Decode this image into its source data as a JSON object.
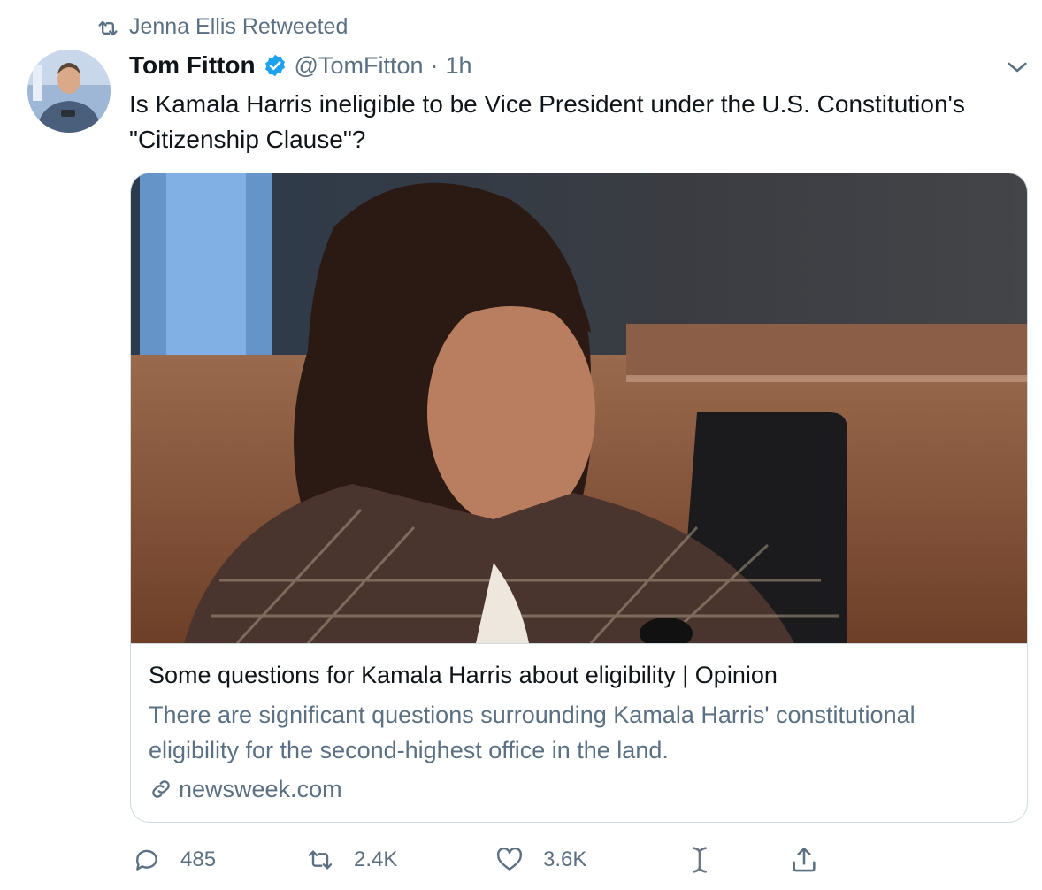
{
  "retweet_context": {
    "icon": "retweet-icon",
    "text": "Jenna Ellis Retweeted"
  },
  "author": {
    "display_name": "Tom Fitton",
    "verified": true,
    "handle": "@TomFitton",
    "separator": "·",
    "timestamp": "1h"
  },
  "tweet": {
    "text": "Is Kamala Harris ineligible to be Vice President under the U.S. Constitution's \"Citizenship Clause\"?"
  },
  "link_card": {
    "title": "Some questions for Kamala Harris about eligibility | Opinion",
    "description": "There are significant questions surrounding Kamala Harris' constitutional eligibility for the second-highest office in the land.",
    "domain": "newsweek.com"
  },
  "actions": {
    "reply_count": "485",
    "retweet_count": "2.4K",
    "like_count": "3.6K"
  },
  "colors": {
    "text_primary": "#0f1419",
    "text_secondary": "#5b7083",
    "verified_blue": "#1da1f2",
    "border": "#cfd9de"
  }
}
